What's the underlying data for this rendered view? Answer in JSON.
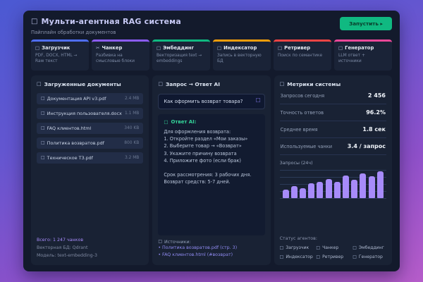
{
  "app": {
    "icon": "□",
    "title": "Мульти-агентная RAG система",
    "subtitle": "Пайплайн обработки документов",
    "run_button": "Запустить ▸"
  },
  "pipeline": [
    {
      "icon": "□",
      "name": "Загрузчик",
      "desc": "PDF, DOCX, HTML → Raw текст",
      "color": "#4f6ef7"
    },
    {
      "icon": "✂",
      "name": "Чанкер",
      "desc": "Разбивка на смысловые блоки",
      "color": "#8b5cf6"
    },
    {
      "icon": "□",
      "name": "Эмбеддинг",
      "desc": "Векторизация text → embeddings",
      "color": "#10b981"
    },
    {
      "icon": "□",
      "name": "Индексатор",
      "desc": "Запись в векторную БД",
      "color": "#f59e0b"
    },
    {
      "icon": "□",
      "name": "Ретривер",
      "desc": "Поиск по семантике",
      "color": "#ef4444"
    },
    {
      "icon": "□",
      "name": "Генератор",
      "desc": "LLM ответ + источники",
      "color": "#ec4899"
    }
  ],
  "documents": {
    "icon": "□",
    "header": "Загруженные документы",
    "file_icon": "□",
    "files": [
      {
        "name": "Документация API v3.pdf",
        "size": "2.4 MB"
      },
      {
        "name": "Инструкция пользователя.docx",
        "size": "1.1 MB"
      },
      {
        "name": "FAQ клиентов.html",
        "size": "340 KB"
      },
      {
        "name": "Политика возвратов.pdf",
        "size": "800 KB"
      },
      {
        "name": "Техническое ТЗ.pdf",
        "size": "3.2 MB"
      }
    ],
    "footer": {
      "total": "Всего: 1 247 чанков",
      "vector_db": "Векторная БД: Qdrant",
      "model": "Модель: text-embedding-3"
    }
  },
  "chat": {
    "icon": "□",
    "header": "Запрос → Ответ AI",
    "query": "Как оформить возврат товара?",
    "search_icon": "□",
    "answer_icon": "□",
    "answer_label": "Ответ AI:",
    "answer_lines": [
      "Для оформления возврата:",
      "1. Откройте раздел «Мои заказы»",
      "2. Выберите товар → «Возврат»",
      "3. Укажите причину возврата",
      "4. Приложите фото (если брак)",
      "",
      "Срок рассмотрения: 3 рабочих дня.",
      "Возврат средств: 5-7 дней."
    ],
    "sources_icon": "□",
    "sources_label": "Источники:",
    "sources": [
      "• Политика возвратов.pdf (стр. 3)",
      "• FAQ клиентов.html (#возврат)"
    ]
  },
  "metrics": {
    "icon": "□",
    "header": "Метрики системы",
    "items": [
      {
        "label": "Запросов сегодня",
        "value": "2 456"
      },
      {
        "label": "Точность ответов",
        "value": "96.2%"
      },
      {
        "label": "Среднее время",
        "value": "1.8 сек"
      },
      {
        "label": "Используемые чанки",
        "value": "3.4 / запрос"
      }
    ],
    "chart_label": "Запросы (24ч)",
    "status_label": "Статус агентов:",
    "agent_icon": "□",
    "agents": [
      "Загрузчик",
      "Чанкер",
      "Эмбеддинг",
      "Индексатор",
      "Ретривер",
      "Генератор"
    ]
  },
  "chart_data": {
    "type": "bar",
    "title": "Запросы (24ч)",
    "categories": [
      "",
      "",
      "",
      "",
      "",
      "",
      "",
      "",
      "",
      "",
      "",
      ""
    ],
    "values": [
      30,
      42,
      35,
      52,
      58,
      68,
      58,
      80,
      65,
      88,
      78,
      95
    ],
    "xlabel": "",
    "ylabel": "",
    "ylim": [
      0,
      100
    ],
    "grid": true,
    "legend": false,
    "bar_color": "#a78bfa"
  },
  "colors": {
    "accent_green": "#10b981",
    "accent_purple": "#a78bfa",
    "link_purple": "#8f8af0",
    "answer_green": "#34d399"
  }
}
